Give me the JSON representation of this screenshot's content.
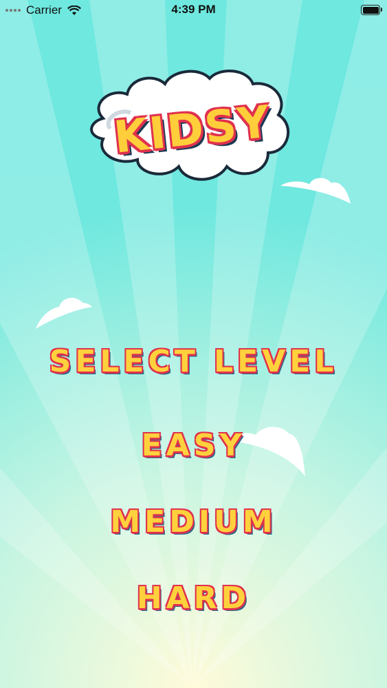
{
  "statusbar": {
    "carrier": "Carrier",
    "time": "4:39 PM"
  },
  "logo": {
    "text": "KIDSY"
  },
  "menu": {
    "title": "SELECT LEVEL",
    "easy": "EASY",
    "medium": "MEDIUM",
    "hard": "HARD"
  },
  "colors": {
    "sky": "#6fe8df",
    "text_fill": "#ffd13c",
    "text_outline": "#e0314e"
  }
}
